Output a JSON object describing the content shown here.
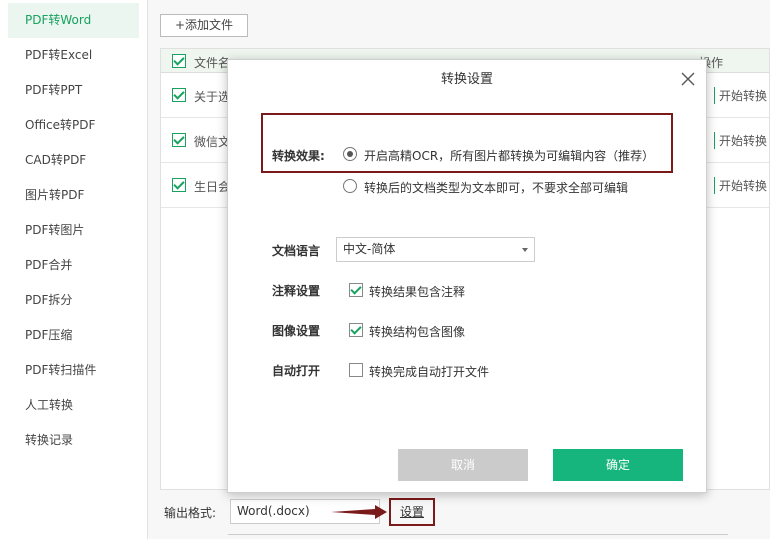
{
  "sidebar": {
    "items": [
      {
        "label": "PDF转Word"
      },
      {
        "label": "PDF转Excel"
      },
      {
        "label": "PDF转PPT"
      },
      {
        "label": "Office转PDF"
      },
      {
        "label": "CAD转PDF"
      },
      {
        "label": "图片转PDF"
      },
      {
        "label": "PDF转图片"
      },
      {
        "label": "PDF合并"
      },
      {
        "label": "PDF拆分"
      },
      {
        "label": "PDF压缩"
      },
      {
        "label": "PDF转扫描件"
      },
      {
        "label": "人工转换"
      },
      {
        "label": "转换记录"
      }
    ]
  },
  "main": {
    "add_file_label": "+添加文件",
    "table": {
      "col_name": "文件名",
      "col_action": "操作",
      "rows": [
        {
          "name": "关于选",
          "action": "开始转换"
        },
        {
          "name": "微信文",
          "action": "开始转换"
        },
        {
          "name": "生日会",
          "action": "开始转换"
        }
      ]
    },
    "output_label": "输出格式:",
    "output_value": "Word(.docx)",
    "settings_label": "设置"
  },
  "dialog": {
    "title": "转换设置",
    "effect_label": "转换效果:",
    "effect_option_1": "开启高精OCR，所有图片都转换为可编辑内容（推荐）",
    "effect_option_2": "转换后的文档类型为文本即可，不要求全部可编辑",
    "language_label": "文档语言",
    "language_value": "中文-简体",
    "annotation_label": "注释设置",
    "annotation_option": "转换结果包含注释",
    "image_label": "图像设置",
    "image_option": "转换结构包含图像",
    "autoopen_label": "自动打开",
    "autoopen_option": "转换完成自动打开文件",
    "cancel_label": "取消",
    "ok_label": "确定"
  },
  "colors": {
    "accent": "#19a15f",
    "ok_button": "#17b57e",
    "highlight_border": "#7a1a1a"
  }
}
